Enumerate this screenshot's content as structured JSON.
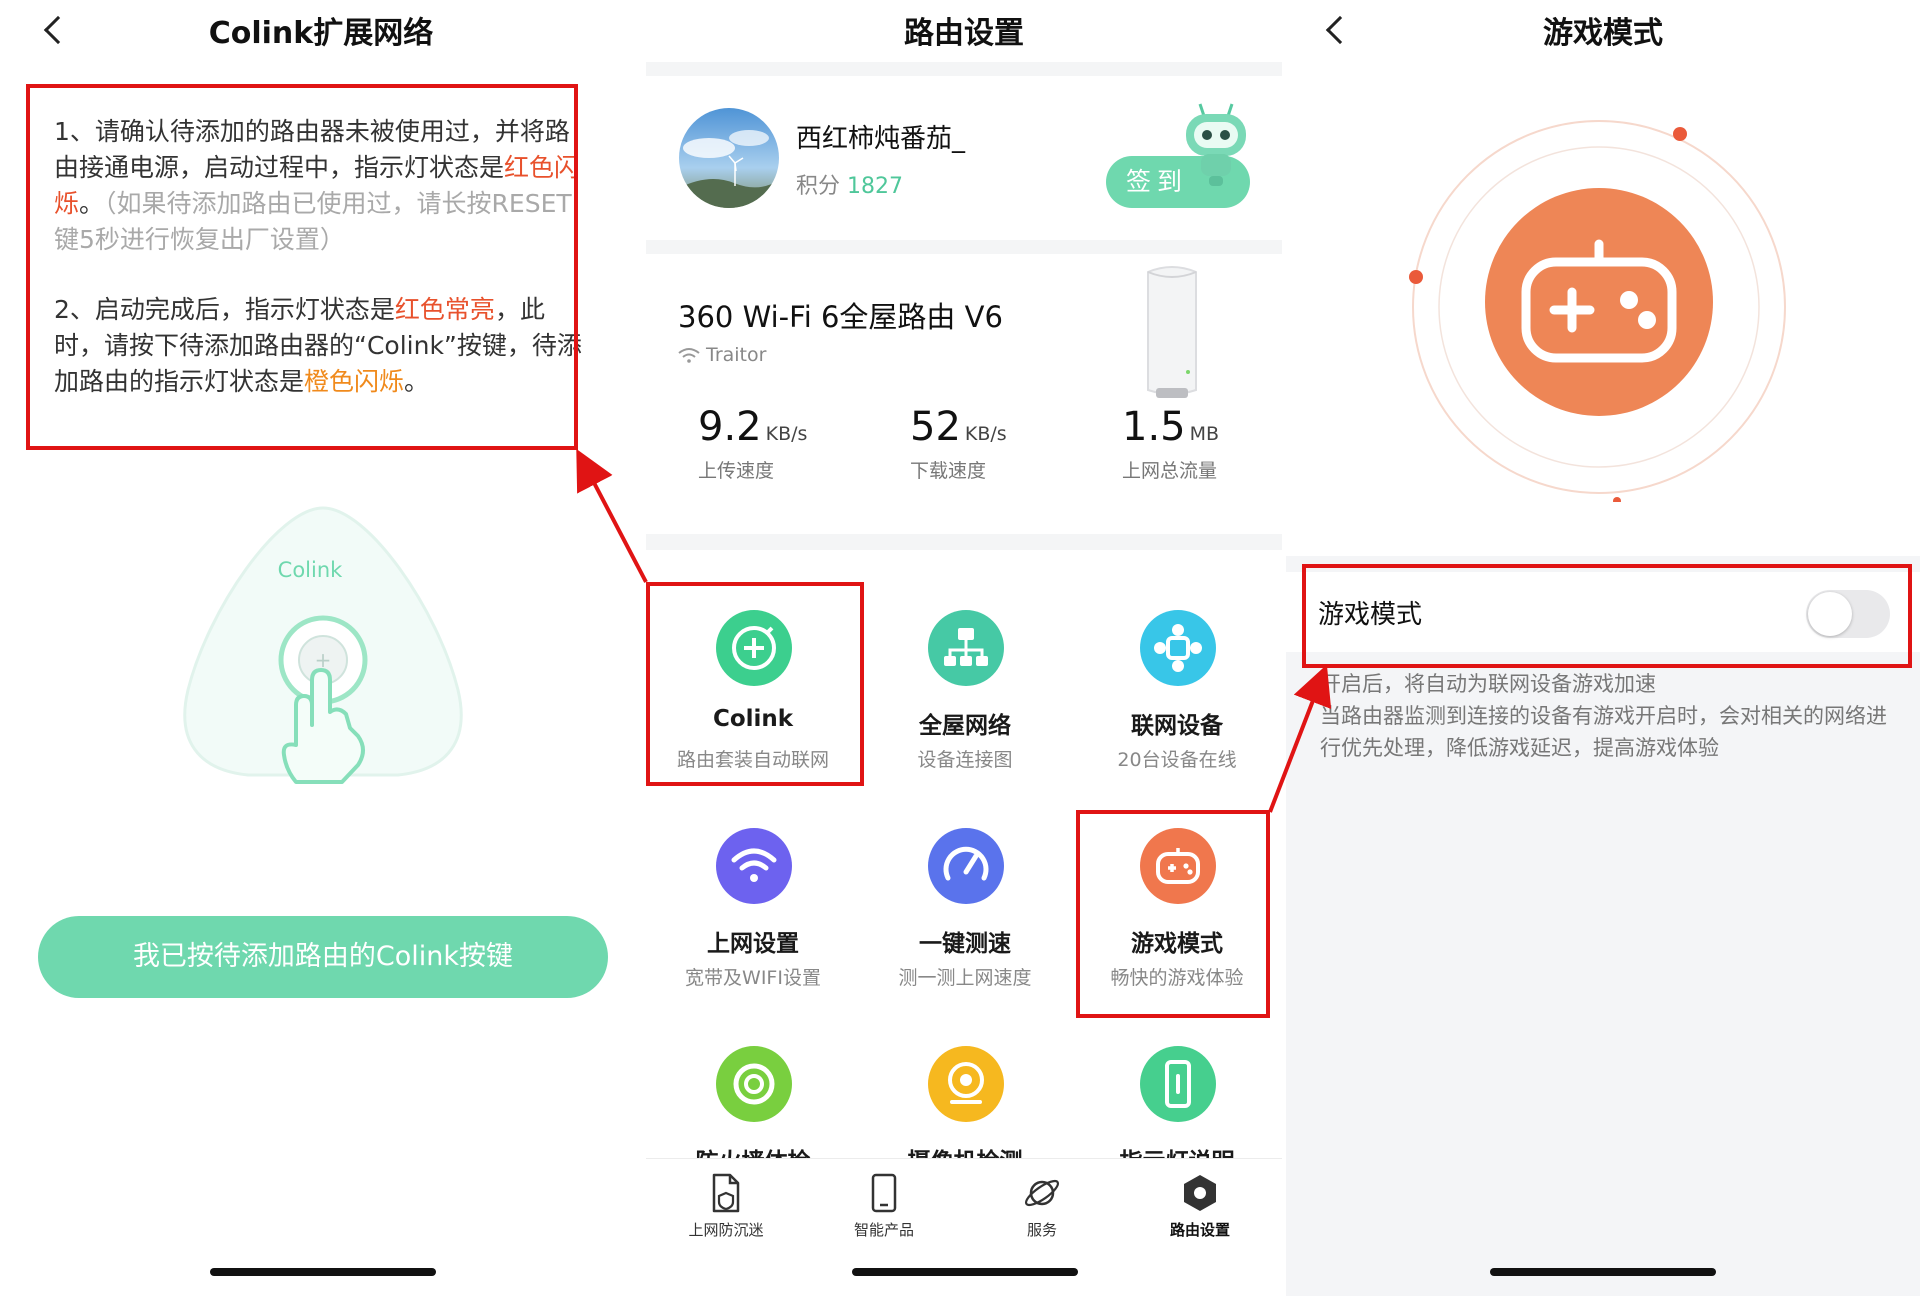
{
  "panel1": {
    "title": "Colink扩展网络",
    "step1_a": "1、请确认待添加的路由器未被使用过，并将路由接通电源，启动过程中，指示灯状态是",
    "step1_red": "红色闪烁",
    "step1_b": "。",
    "step1_note": "（如果待添加路由已使用过，请长按RESET键5秒进行恢复出厂设置）",
    "step2_a": "2、启动完成后，指示灯状态是",
    "step2_red": "红色常亮",
    "step2_b": "，此时，请按下待添加路由器的“Colink”按键，待添加路由的指示灯状态是",
    "step2_orange": "橙色闪烁",
    "step2_c": "。",
    "device_label": "Colink",
    "button_label": "我已按待添加路由的Colink按键"
  },
  "panel2": {
    "title": "路由设置",
    "user": {
      "name": "西红柿炖番茄_",
      "points_label": "积分",
      "points_value": "1827",
      "signin_label": "签到"
    },
    "router": {
      "name": "360 Wi-Fi 6全屋路由 V6",
      "ssid": "Traitor",
      "stats": [
        {
          "value": "9.2",
          "unit": "KB/s",
          "label": "上传速度"
        },
        {
          "value": "52",
          "unit": "KB/s",
          "label": "下载速度"
        },
        {
          "value": "1.5",
          "unit": "MB",
          "label": "上网总流量"
        }
      ]
    },
    "tiles": [
      {
        "title": "Colink",
        "subtitle": "路由套装自动联网",
        "icon": "colink-icon",
        "color": "#3ccf8e"
      },
      {
        "title": "全屋网络",
        "subtitle": "设备连接图",
        "icon": "network-topology-icon",
        "color": "#46c9a5"
      },
      {
        "title": "联网设备",
        "subtitle": "20台设备在线",
        "icon": "devices-icon",
        "color": "#38c6e8"
      },
      {
        "title": "上网设置",
        "subtitle": "宽带及WIFI设置",
        "icon": "wifi-icon",
        "color": "#6d62ef"
      },
      {
        "title": "一键测速",
        "subtitle": "测一测上网速度",
        "icon": "speedometer-icon",
        "color": "#5a73ec"
      },
      {
        "title": "游戏模式",
        "subtitle": "畅快的游戏体验",
        "icon": "gamepad-icon",
        "color": "#f0774d"
      },
      {
        "title": "防火墙体检",
        "subtitle": "",
        "icon": "firewall-icon",
        "color": "#79cf3f"
      },
      {
        "title": "摄像机检测",
        "subtitle": "",
        "icon": "camera-icon",
        "color": "#f6b81f"
      },
      {
        "title": "指示灯说明",
        "subtitle": "",
        "icon": "indicator-icon",
        "color": "#46cf8e"
      }
    ],
    "tabbar": [
      {
        "label": "上网防沉迷",
        "icon": "document-shield-icon"
      },
      {
        "label": "智能产品",
        "icon": "tablet-icon"
      },
      {
        "label": "服务",
        "icon": "planet-icon"
      },
      {
        "label": "路由设置",
        "icon": "hexagon-gear-icon"
      }
    ]
  },
  "panel3": {
    "title": "游戏模式",
    "toggle_label": "游戏模式",
    "toggle_on": false,
    "desc_line1": "开启后，将自动为联网设备游戏加速",
    "desc_line2": "当路由器监测到连接的设备有游戏开启时，会对相关的网络进行优先处理，降低游戏延迟，提高游戏体验",
    "accent": "#ee8656"
  }
}
